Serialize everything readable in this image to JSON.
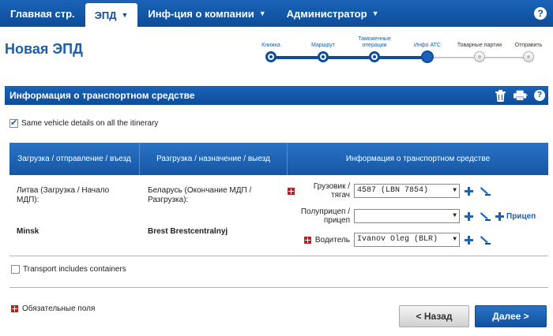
{
  "nav": {
    "items": [
      {
        "label": "Главная стр.",
        "caret": ""
      },
      {
        "label": "ЭПД",
        "caret": "▼"
      },
      {
        "label": "Инф-ция о компании",
        "caret": "▼"
      },
      {
        "label": "Администратор",
        "caret": "▼"
      }
    ],
    "help": "?"
  },
  "page": {
    "title": "Новая ЭПД"
  },
  "stepper": {
    "steps": [
      {
        "label": "Книжка",
        "state": "done"
      },
      {
        "label": "Маршрут",
        "state": "done"
      },
      {
        "label": "Таможенные операции",
        "state": "done"
      },
      {
        "label": "Инфо АТС",
        "state": "current"
      },
      {
        "label": "Товарные партии",
        "state": "todo"
      },
      {
        "label": "Отправить",
        "state": "todo"
      }
    ]
  },
  "section": {
    "title": "Информация о транспортном средстве",
    "help": "?"
  },
  "same_vehicle": {
    "label": "Same vehicle details on all the itinerary",
    "checked": true
  },
  "table": {
    "headers": [
      "Загрузка / отправление / въезд",
      "Разгрузка / назначение / выезд",
      "Информация о транспортном средстве"
    ],
    "loading_place": "Литва (Загрузка / Начало МДП):",
    "loading_point": "Minsk",
    "unloading_place": "Беларусь (Окончание МДП / Разгрузка):",
    "unloading_point": "Brest Brestcentralnyj",
    "vehicles": {
      "truck_label": "Грузовик / тягач",
      "truck_value": "4587 (LBN 7854)",
      "trailer_label": "Полуприцеп / прицеп",
      "trailer_value": "",
      "add_trailer_label": "Прицеп",
      "driver_label": "Водитель",
      "driver_value": "Ivanov Oleg (BLR)"
    }
  },
  "containers": {
    "label": "Transport includes containers",
    "checked": false
  },
  "footer": {
    "required_legend": "Обязательные поля",
    "back_label": "< Назад",
    "next_label": "Далее >"
  },
  "colors": {
    "primary": "#0d4d99",
    "accent": "#1a63b8",
    "required": "#b82020"
  }
}
